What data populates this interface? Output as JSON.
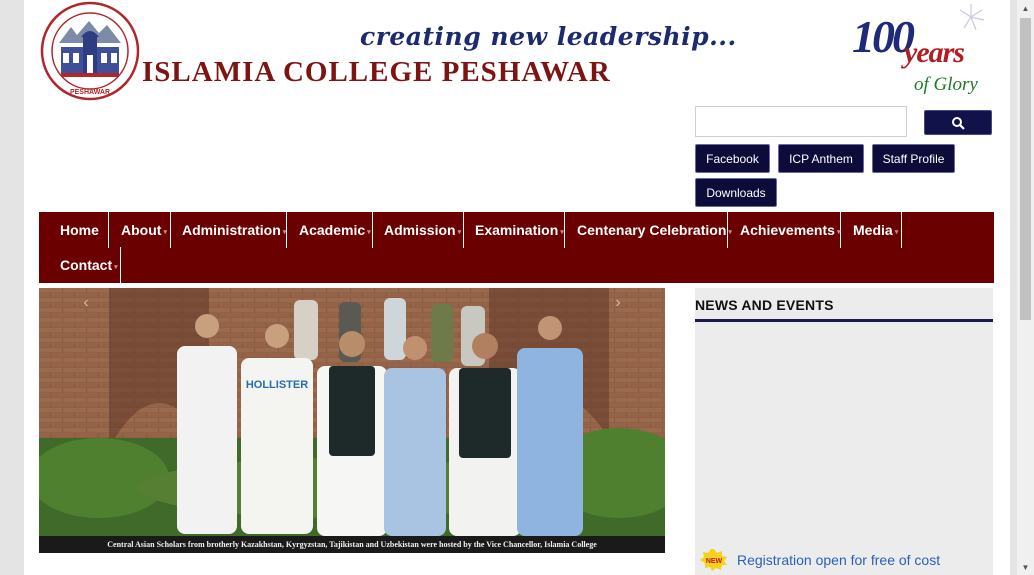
{
  "header": {
    "tagline": "creating new leadership...",
    "college_name": "ISLAMIA COLLEGE PESHAWAR",
    "logo_text": "PESHAWAR",
    "badge": {
      "number": "100",
      "years": "years",
      "glory": "of Glory"
    }
  },
  "search": {
    "value": "",
    "placeholder": "",
    "icon": "search-icon"
  },
  "quick_links": [
    "Facebook",
    "ICP Anthem",
    "Staff Profile",
    "Downloads"
  ],
  "nav": {
    "items": [
      "Home",
      "About",
      "Administration",
      "Academic",
      "Admission",
      "Examination",
      "Centenary Celebration",
      "Achievements",
      "Media",
      "Contact"
    ]
  },
  "slider": {
    "caption": "Central Asian Scholars from brotherly Kazakhstan, Kyrgyzstan, Tajikistan and Uzbekistan were hosted by the Vice Chancellor, Islamia College",
    "shirt_text": "HOLLISTER"
  },
  "news": {
    "heading": "NEWS AND EVENTS",
    "badge": "NEW",
    "item": "Registration open for free of cost"
  },
  "colors": {
    "nav_bg": "#6b0001",
    "button_bg": "#0c0b3a",
    "link": "#2a5fb8",
    "heading_rule": "#1a1a4a"
  }
}
